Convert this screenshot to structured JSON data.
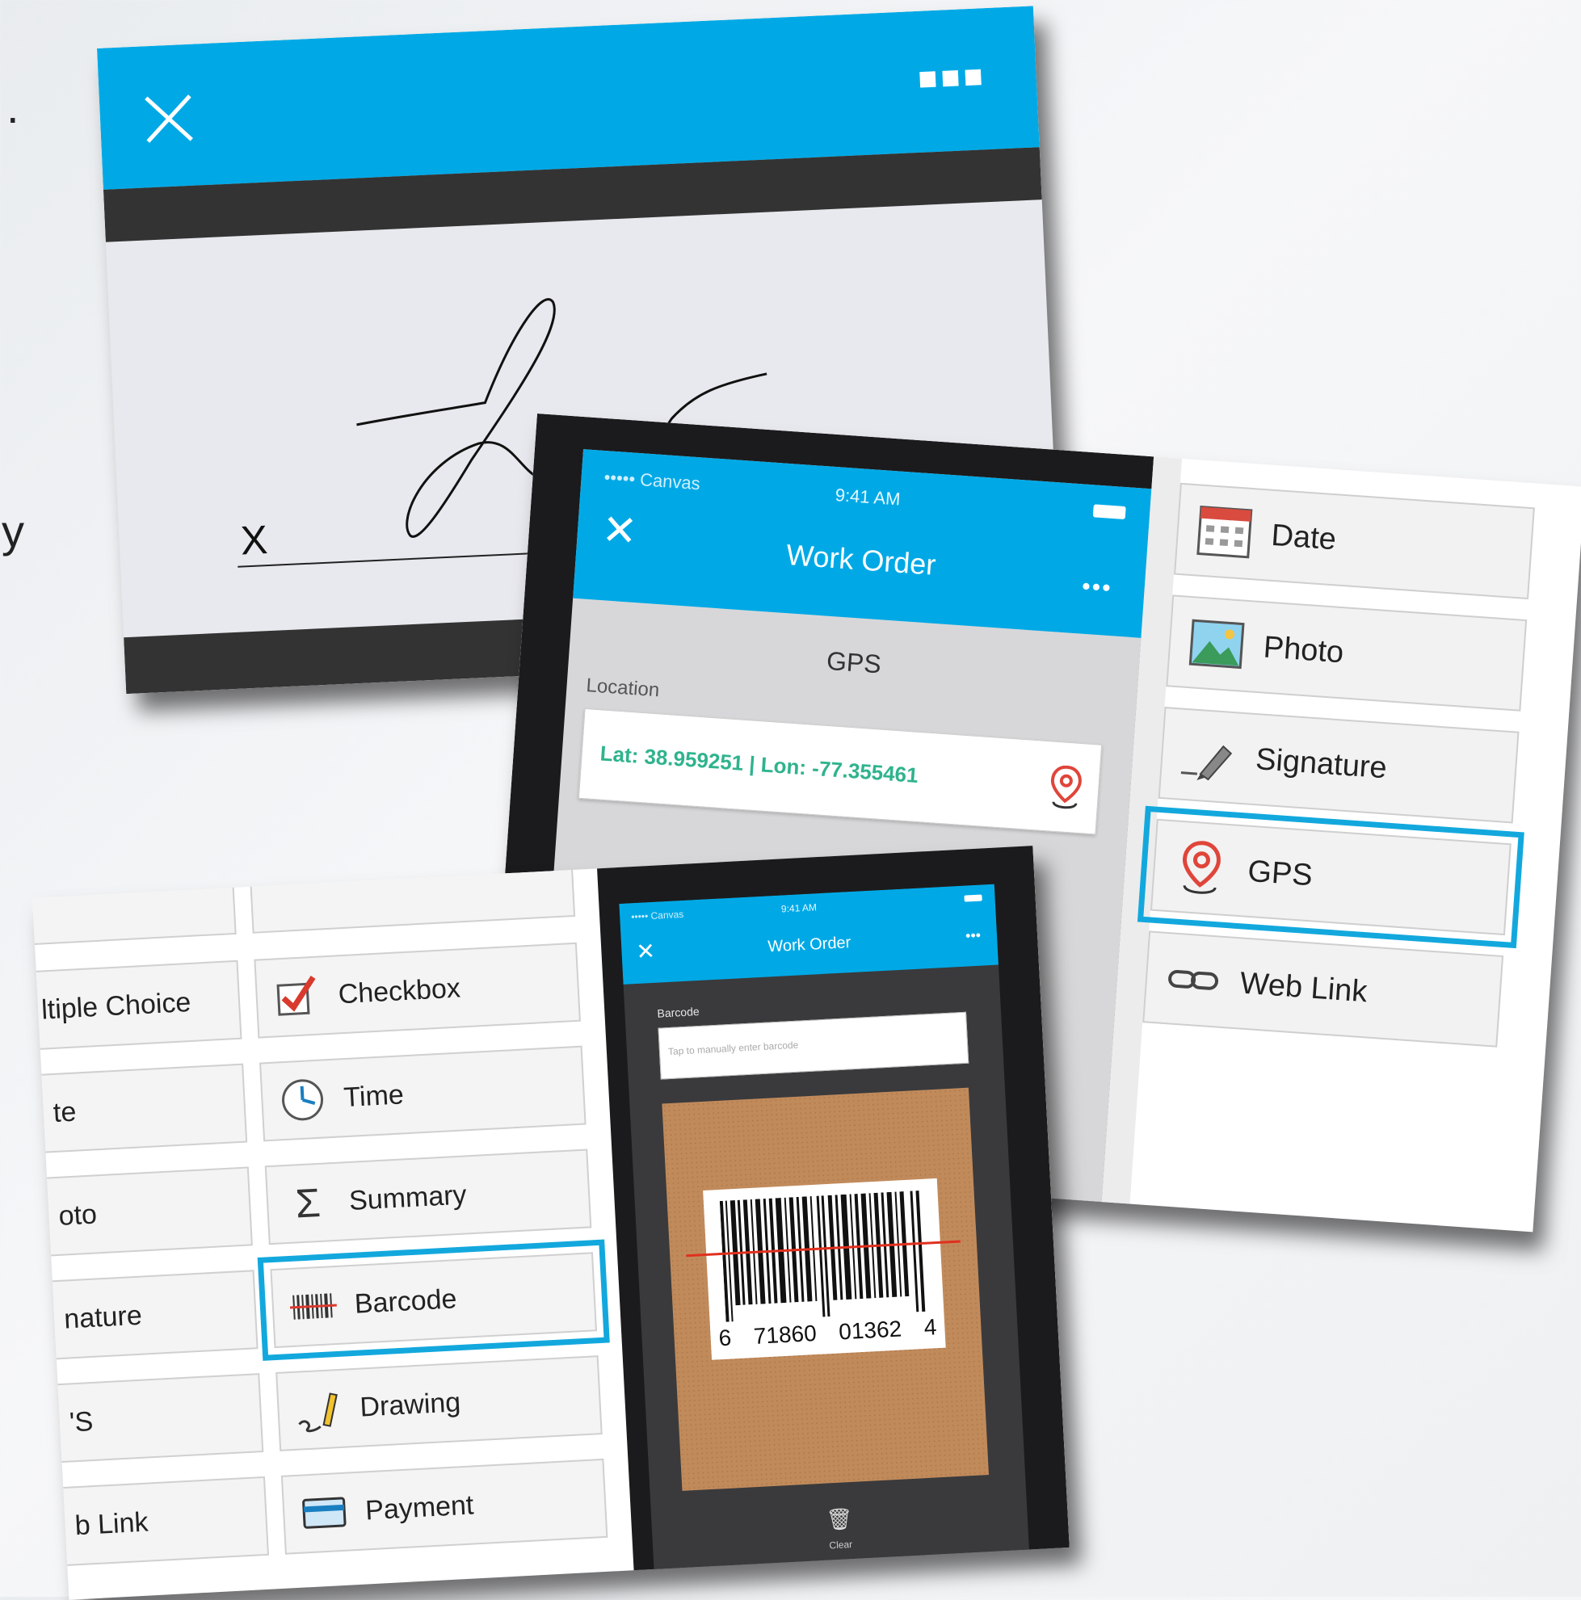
{
  "background_text": {
    "dot": ".",
    "y_char": "y"
  },
  "signature_panel": {
    "x_marker": "X",
    "accent_color": "#00a9e6"
  },
  "gps_panel": {
    "status": {
      "carrier": "••••• Canvas",
      "time": "9:41 AM"
    },
    "app_title": "Work Order",
    "field_title": "GPS",
    "field_label": "Location",
    "coordinates": "Lat: 38.959251 | Lon: -77.355461",
    "field_types": [
      {
        "label": "Date",
        "icon": "calendar-icon"
      },
      {
        "label": "Photo",
        "icon": "photo-icon"
      },
      {
        "label": "Signature",
        "icon": "pen-icon"
      },
      {
        "label": "GPS",
        "icon": "map-pin-icon",
        "selected": true
      },
      {
        "label": "Web Link",
        "icon": "link-icon"
      }
    ]
  },
  "barcode_panel": {
    "left_column": [
      "ltiple Choice",
      "te",
      "oto",
      "nature",
      "'S",
      "b Link"
    ],
    "right_column": [
      {
        "label": "Checkbox",
        "icon": "checkbox-icon"
      },
      {
        "label": "Time",
        "icon": "clock-icon"
      },
      {
        "label": "Summary",
        "icon": "sigma-icon"
      },
      {
        "label": "Barcode",
        "icon": "barcode-icon",
        "selected": true
      },
      {
        "label": "Drawing",
        "icon": "pencil-icon"
      },
      {
        "label": "Payment",
        "icon": "card-icon"
      }
    ],
    "phone": {
      "status": {
        "carrier": "••••• Canvas",
        "time": "9:41 AM"
      },
      "app_title": "Work Order",
      "field_label": "Barcode",
      "placeholder": "Tap to manually enter barcode",
      "barcode_digits": [
        "6",
        "71860",
        "01362",
        "4"
      ],
      "clear_label": "Clear"
    }
  }
}
